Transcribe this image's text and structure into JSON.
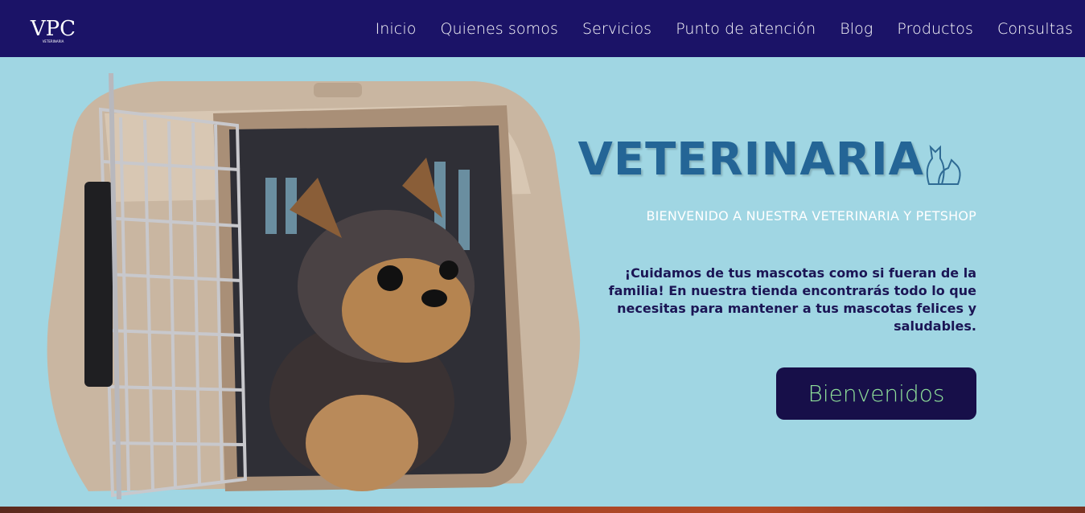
{
  "header": {
    "logo_text": "VPC",
    "logo_subtext": "VETERINARIA",
    "nav": [
      {
        "label": "Inicio"
      },
      {
        "label": "Quienes somos"
      },
      {
        "label": "Servicios"
      },
      {
        "label": "Punto de atención"
      },
      {
        "label": "Blog"
      },
      {
        "label": "Productos"
      },
      {
        "label": "Consultas"
      }
    ]
  },
  "hero": {
    "title": "VETERINARIA",
    "title_icon": "cat-dog-icon",
    "subtitle": "BIENVENIDO A NUESTRA VETERINARIA Y PETSHOP",
    "text": "¡Cuidamos de tus mascotas como si fueran de la familia! En nuestra tienda encontrarás todo lo que necesitas para mantener a tus mascotas felices y saludables.",
    "button_label": "Bienvenidos",
    "image": "puppy-in-pet-carrier"
  },
  "colors": {
    "navbar": "#1b1367",
    "hero_bg": "#a0d6e3",
    "title": "#246596",
    "button_bg": "#170f49",
    "button_text": "#8fe09a"
  }
}
